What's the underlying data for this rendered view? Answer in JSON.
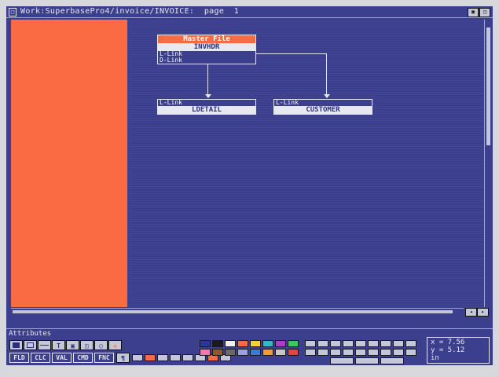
{
  "window": {
    "title": "Work:SuperbasePro4/invoice/INVOICE:  page  1"
  },
  "diagram": {
    "master": {
      "header": "Master File",
      "name": "INVHDR",
      "link1": "L-Link",
      "link2": "D-Link"
    },
    "child1": {
      "link": "L-Link",
      "name": "LDETAIL"
    },
    "child2": {
      "link": "L-Link",
      "name": "CUSTOMER"
    }
  },
  "attributes": {
    "label": "Attributes",
    "mode_buttons": [
      "FLD",
      "CLC",
      "VAL",
      "CMD",
      "FNC"
    ],
    "tool_icons": [
      "filled-rect-icon",
      "rect-icon",
      "line-icon",
      "text-icon",
      "image-icon",
      "clip-icon",
      "ellipse-icon",
      "crosshair-icon"
    ],
    "palette": [
      "#2c3896",
      "#1a1a1a",
      "#f0f0f0",
      "#fa6a43",
      "#f2d13a",
      "#36b6c9",
      "#b23ac9",
      "#3ac95a",
      "#f07ab0",
      "#8a5a2a",
      "#6a6a6a",
      "#9aa0e0",
      "#3a7bd5",
      "#f29b38",
      "#c8c8c8",
      "#e24444"
    ],
    "readout": {
      "x": "x = 7.56",
      "y": "y = 5.12",
      "unit": "in"
    }
  }
}
